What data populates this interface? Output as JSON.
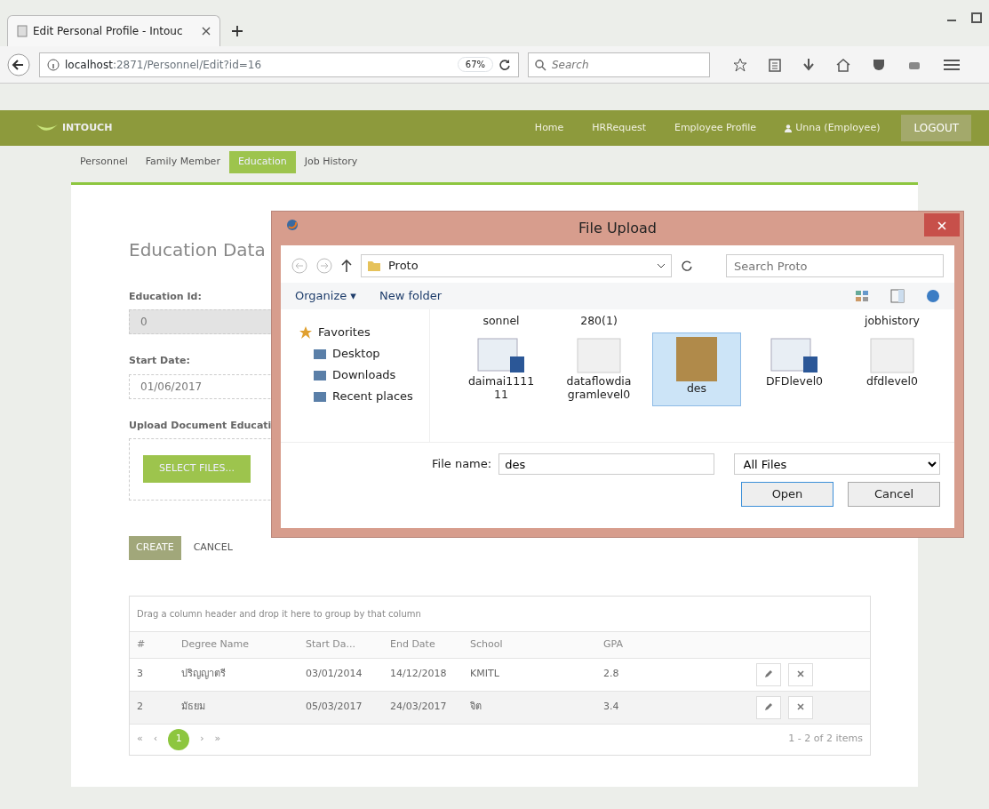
{
  "browser": {
    "tab_title": "Edit Personal Profile - Intouc",
    "url_host": "localhost",
    "url_path": ":2871/Personnel/Edit?id=16",
    "zoom": "67%",
    "search_placeholder": "Search"
  },
  "navbar": {
    "brand": "INTOUCH",
    "links": [
      "Home",
      "HRRequest",
      "Employee Profile"
    ],
    "user": "Unna (Employee)",
    "logout": "LOGOUT"
  },
  "subtabs": [
    {
      "label": "Personnel",
      "selected": false
    },
    {
      "label": "Family Member",
      "selected": false
    },
    {
      "label": "Education",
      "selected": true
    },
    {
      "label": "Job History",
      "selected": false
    }
  ],
  "form": {
    "title": "Education Data",
    "fields": [
      {
        "label": "Education Id:",
        "value": "0",
        "disabled": true
      },
      {
        "label": "Start Date:",
        "value": "01/06/2017",
        "disabled": false
      }
    ],
    "upload_label": "Upload Document Educati",
    "select_button": "SELECT FILES...",
    "create": "CREATE",
    "cancel": "CANCEL"
  },
  "grid": {
    "group_hint": "Drag a column header and drop it here to group by that column",
    "columns": [
      "#",
      "Degree Name",
      "Start Da...",
      "End Date",
      "School",
      "GPA"
    ],
    "rows": [
      {
        "cells": [
          "3",
          "ปริญญาตรี",
          "03/01/2014",
          "14/12/2018",
          "KMITL",
          "2.8"
        ]
      },
      {
        "cells": [
          "2",
          "มัธยม",
          "05/03/2017",
          "24/03/2017",
          "จิต",
          "3.4"
        ]
      }
    ],
    "pager": {
      "first": "«",
      "prev": "‹",
      "page": "1",
      "next": "›",
      "last": "»",
      "summary": "1 - 2 of 2 items"
    }
  },
  "dialog": {
    "title": "File Upload",
    "path": "Proto",
    "search_placeholder": "Search Proto",
    "organize": "Organize ▾",
    "new_folder": "New folder",
    "nav_items": [
      {
        "label": "Favorites",
        "kind": "group"
      },
      {
        "label": "Desktop",
        "kind": "place"
      },
      {
        "label": "Downloads",
        "kind": "place"
      },
      {
        "label": "Recent places",
        "kind": "place"
      }
    ],
    "files": [
      {
        "label": "sonnel",
        "kind": "cut",
        "selected": false
      },
      {
        "label": "280(1)",
        "kind": "cut",
        "selected": false
      },
      {
        "kind": "gap",
        "selected": false
      },
      {
        "kind": "gap",
        "selected": false
      },
      {
        "label": "jobhistory",
        "kind": "cut",
        "selected": false
      },
      {
        "label": "daimai1111 11",
        "kind": "doc",
        "selected": false
      },
      {
        "label": "dataflowdia gramlevel0",
        "kind": "blank",
        "selected": false
      },
      {
        "label": "des",
        "kind": "photo",
        "selected": true
      },
      {
        "label": "DFDlevel0",
        "kind": "doc",
        "selected": false
      },
      {
        "label": "dfdlevel0",
        "kind": "blank",
        "selected": false
      }
    ],
    "filename_label": "File name:",
    "filename": "des",
    "filetype": "All Files",
    "open": "Open",
    "cancel": "Cancel"
  }
}
